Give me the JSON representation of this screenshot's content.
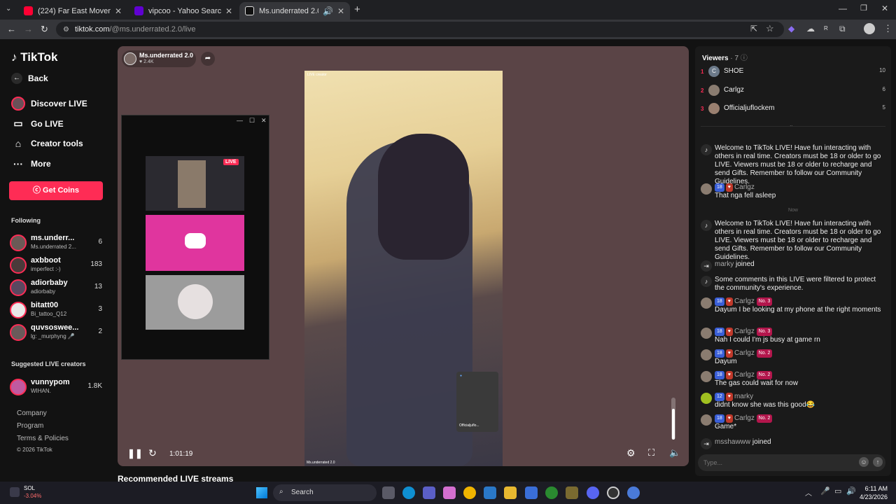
{
  "browser": {
    "tabs": [
      {
        "title": "(224) Far East Movement - Like",
        "icon": "youtube-icon",
        "color": "#ff0033"
      },
      {
        "title": "vipcoo - Yahoo Search Results",
        "icon": "yahoo-icon",
        "color": "#6001d2"
      },
      {
        "title": "Ms.underrated 2.0 (@ms.un",
        "icon": "tiktok-icon",
        "color": "#ffffff"
      }
    ],
    "url_host": "tiktok.com",
    "url_path": "/@ms.underrated.2.0/live"
  },
  "sidebar": {
    "logo": "TikTok",
    "back": "Back",
    "nav": [
      {
        "label": "Discover LIVE",
        "icon": "live-avatar-icon"
      },
      {
        "label": "Go LIVE",
        "icon": "camera-icon"
      },
      {
        "label": "Creator tools",
        "icon": "home-icon"
      },
      {
        "label": "More",
        "icon": "ellipsis-icon"
      }
    ],
    "get_coins": "Get Coins",
    "following_title": "Following",
    "following": [
      {
        "name": "ms.underr...",
        "sub": "Ms.underrated 2...",
        "count": "6"
      },
      {
        "name": "axbboot",
        "sub": "imperfect :-)",
        "count": "183"
      },
      {
        "name": "adiorbaby",
        "sub": "adiorbaby",
        "count": "13"
      },
      {
        "name": "bitatt00",
        "sub": "Bi_tattoo_Q12",
        "count": "3"
      },
      {
        "name": "quvsoswee...",
        "sub": "lg: _murphyng 🎤",
        "count": "2"
      }
    ],
    "suggested_title": "Suggested LIVE creators",
    "suggested": [
      {
        "name": "vunnypom",
        "sub": "WIHAN.",
        "count": "1.8K"
      }
    ],
    "footer": [
      "Company",
      "Program",
      "Terms & Policies",
      "© 2026 TikTok"
    ]
  },
  "stream": {
    "creator_name": "Ms.underrated 2.0",
    "likes": "♥ 2.4K",
    "feed_tag": "LIVE creator",
    "feed_footer": "Ms.underrated 2.0",
    "inset_label": "Officialjuflo...",
    "elapsed": "1:01:19",
    "recommended_title": "Recommended LIVE streams",
    "mini_live_badge": "LIVE"
  },
  "viewers": {
    "title": "Viewers",
    "count": "· 7",
    "list": [
      {
        "rank": "1",
        "name": "SHOE",
        "score": "10",
        "initial": "C"
      },
      {
        "rank": "2",
        "name": "Carlgz",
        "score": "6",
        "initial": ""
      },
      {
        "rank": "3",
        "name": "Officialjuflockem",
        "score": "5",
        "initial": ""
      }
    ]
  },
  "chat": {
    "sep_now": "Now",
    "welcome": "Welcome to TikTok LIVE! Have fun interacting with others in real time. Creators must be 18 or older to go LIVE. Viewers must be 18 or older to recharge and send Gifts. Remember to follow our Community Guidelines.",
    "filtered": "Some comments in this LIVE were filtered to protect the community's experience.",
    "joined_1_name": "marky",
    "joined_2_name": "msshawww",
    "joined_text": "joined",
    "messages": [
      {
        "user": "Carlgz",
        "lvl": "18",
        "rank": "",
        "text": "That nga fell asleep"
      },
      {
        "user": "Carlgz",
        "lvl": "18",
        "rank": "No. 3",
        "text": "Dayum I be looking at my phone at the right moments"
      },
      {
        "user": "Carlgz",
        "lvl": "18",
        "rank": "No. 3",
        "text": "Nah I could I'm js busy at game rn"
      },
      {
        "user": "Carlgz",
        "lvl": "18",
        "rank": "No. 2",
        "text": "Dayum"
      },
      {
        "user": "Carlgz",
        "lvl": "18",
        "rank": "No. 2",
        "text": "The gas could wait for now"
      },
      {
        "user": "marky",
        "lvl": "12",
        "rank": "",
        "text": "didnt know she was this good😂"
      },
      {
        "user": "Carlgz",
        "lvl": "18",
        "rank": "No. 2",
        "text": "Game*"
      }
    ],
    "input_placeholder": "Type..."
  },
  "taskbar": {
    "stock_name": "SOL",
    "stock_change": "-3.04%",
    "search": "Search",
    "time": "6:11 AM",
    "date": "4/23/2026"
  }
}
